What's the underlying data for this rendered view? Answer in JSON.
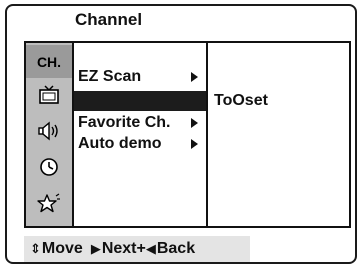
{
  "title": "Channel",
  "sidebar": {
    "items": [
      {
        "label": "CH.",
        "icon": "channel-icon",
        "active": true
      },
      {
        "label": "",
        "icon": "tv-icon"
      },
      {
        "label": "",
        "icon": "speaker-icon"
      },
      {
        "label": "",
        "icon": "clock-icon"
      },
      {
        "label": "",
        "icon": "star-icon"
      }
    ]
  },
  "menu": {
    "items": [
      {
        "label": "EZ Scan",
        "has_submenu": true
      },
      {
        "label": "",
        "selected": true
      },
      {
        "label": "Favorite Ch.",
        "has_submenu": true
      },
      {
        "label": "Auto demo",
        "has_submenu": true
      }
    ]
  },
  "submenu": {
    "text": "ToOset"
  },
  "footer": {
    "move_label": "Move",
    "next_label": "Next+",
    "back_label": "Back"
  },
  "colors": {
    "sidebar_bg": "#bdbdbd",
    "sidebar_active_bg": "#9a9a9a",
    "selection_bg": "#1c1c1c",
    "nav_bg": "#e4e4e4"
  }
}
